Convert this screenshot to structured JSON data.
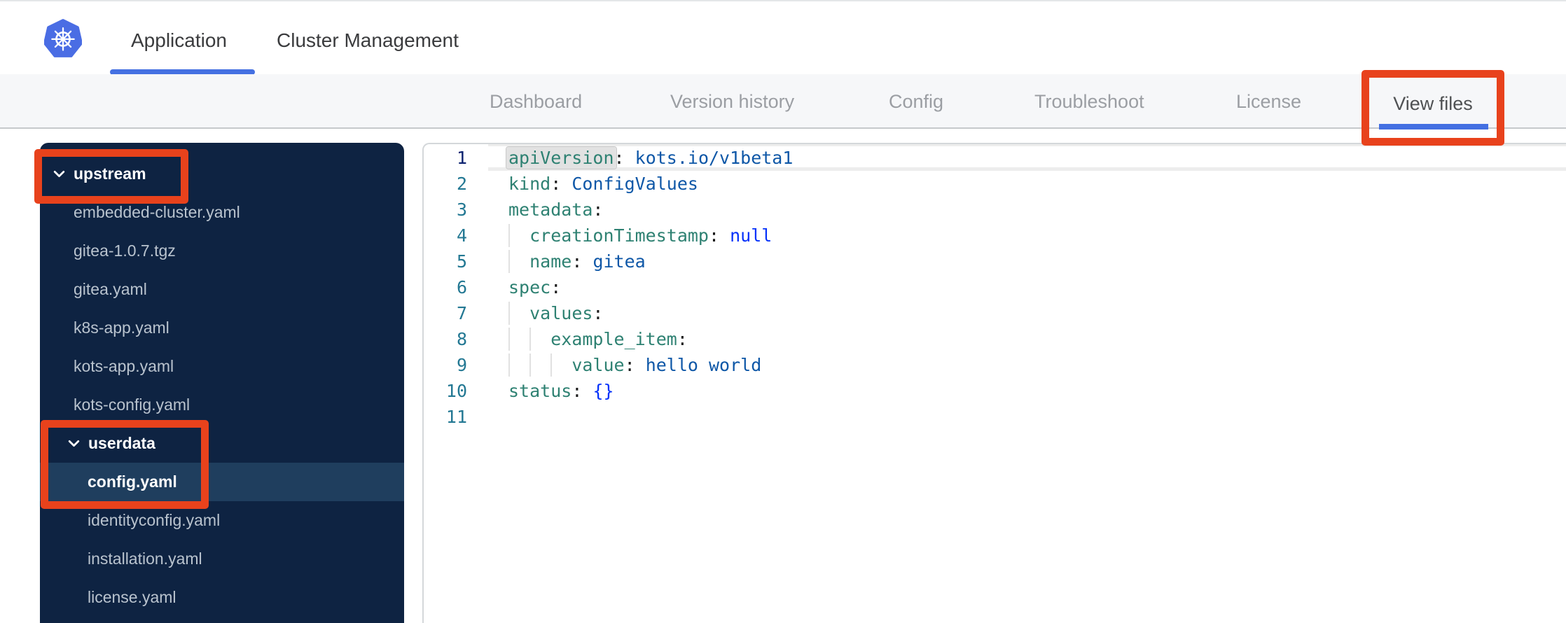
{
  "header": {
    "logo": "kubernetes-logo",
    "tabs": [
      {
        "label": "Application",
        "active": true
      },
      {
        "label": "Cluster Management",
        "active": false
      }
    ]
  },
  "subnav": {
    "items": [
      {
        "label": "Dashboard"
      },
      {
        "label": "Version history"
      },
      {
        "label": "Config"
      },
      {
        "label": "Troubleshoot"
      },
      {
        "label": "License"
      }
    ],
    "active_item": "View files"
  },
  "file_tree": {
    "rows": [
      {
        "label": "upstream",
        "type": "folder",
        "depth": 0,
        "expanded": true
      },
      {
        "label": "embedded-cluster.yaml",
        "type": "file",
        "depth": 1
      },
      {
        "label": "gitea-1.0.7.tgz",
        "type": "file",
        "depth": 1
      },
      {
        "label": "gitea.yaml",
        "type": "file",
        "depth": 1
      },
      {
        "label": "k8s-app.yaml",
        "type": "file",
        "depth": 1
      },
      {
        "label": "kots-app.yaml",
        "type": "file",
        "depth": 1
      },
      {
        "label": "kots-config.yaml",
        "type": "file",
        "depth": 1
      },
      {
        "label": "userdata",
        "type": "folder",
        "depth": 1,
        "expanded": true
      },
      {
        "label": "config.yaml",
        "type": "file",
        "depth": 2,
        "selected": true
      },
      {
        "label": "identityconfig.yaml",
        "type": "file",
        "depth": 2
      },
      {
        "label": "installation.yaml",
        "type": "file",
        "depth": 2
      },
      {
        "label": "license.yaml",
        "type": "file",
        "depth": 2
      }
    ]
  },
  "editor": {
    "language": "yaml",
    "lines": [
      {
        "n": 1,
        "active": true,
        "tokens": [
          [
            "key",
            "apiVersion",
            "hl"
          ],
          [
            "punc",
            ":"
          ],
          [
            "plain",
            " "
          ],
          [
            "val",
            "kots.io/v1beta1"
          ]
        ]
      },
      {
        "n": 2,
        "tokens": [
          [
            "key",
            "kind"
          ],
          [
            "punc",
            ":"
          ],
          [
            "plain",
            " "
          ],
          [
            "val",
            "ConfigValues"
          ]
        ]
      },
      {
        "n": 3,
        "tokens": [
          [
            "key",
            "metadata"
          ],
          [
            "punc",
            ":"
          ]
        ]
      },
      {
        "n": 4,
        "tokens": [
          [
            "plain",
            "  "
          ],
          [
            "key",
            "creationTimestamp"
          ],
          [
            "punc",
            ":"
          ],
          [
            "plain",
            " "
          ],
          [
            "kw",
            "null"
          ]
        ]
      },
      {
        "n": 5,
        "tokens": [
          [
            "plain",
            "  "
          ],
          [
            "key",
            "name"
          ],
          [
            "punc",
            ":"
          ],
          [
            "plain",
            " "
          ],
          [
            "val",
            "gitea"
          ]
        ]
      },
      {
        "n": 6,
        "tokens": [
          [
            "key",
            "spec"
          ],
          [
            "punc",
            ":"
          ]
        ]
      },
      {
        "n": 7,
        "tokens": [
          [
            "plain",
            "  "
          ],
          [
            "key",
            "values"
          ],
          [
            "punc",
            ":"
          ]
        ]
      },
      {
        "n": 8,
        "tokens": [
          [
            "plain",
            "    "
          ],
          [
            "key",
            "example_item"
          ],
          [
            "punc",
            ":"
          ]
        ]
      },
      {
        "n": 9,
        "tokens": [
          [
            "plain",
            "      "
          ],
          [
            "key",
            "value"
          ],
          [
            "punc",
            ":"
          ],
          [
            "plain",
            " "
          ],
          [
            "val",
            "hello world"
          ]
        ]
      },
      {
        "n": 10,
        "tokens": [
          [
            "key",
            "status"
          ],
          [
            "punc",
            ":"
          ],
          [
            "plain",
            " "
          ],
          [
            "kw",
            "{}"
          ]
        ]
      },
      {
        "n": 11,
        "tokens": []
      }
    ]
  },
  "annotations": {
    "color": "#e8421c",
    "boxes": [
      "view-files-tab",
      "upstream-folder",
      "userdata-config-group"
    ]
  },
  "colors": {
    "accent_blue": "#4470e2",
    "logo_blue": "#4a6de4",
    "sidebar_bg": "#0e2342",
    "sidebar_highlight": "#1f3e5e",
    "key_teal": "#2e8172",
    "value_blue": "#0e57a7",
    "keyword_blue": "#0431fa",
    "line_number": "#237893",
    "annotation_red": "#e8421c"
  }
}
